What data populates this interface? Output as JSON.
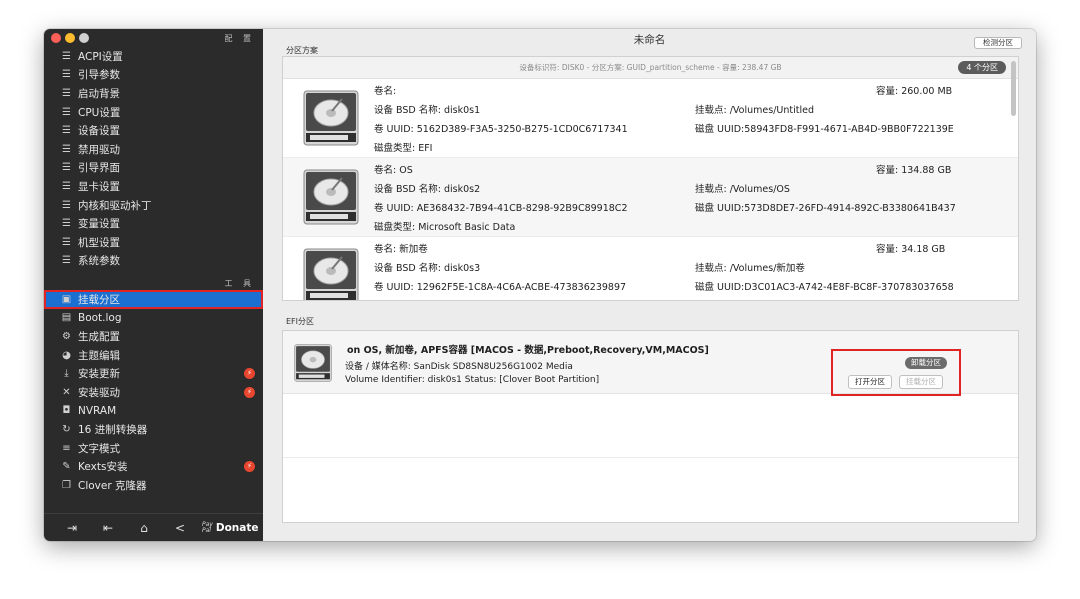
{
  "window": {
    "title": "未命名",
    "detect_button": "检测分区"
  },
  "sidebar": {
    "section_config": "配 置",
    "section_tools": "工 具",
    "config_items": [
      {
        "label": "ACPI设置",
        "icon": "list-icon"
      },
      {
        "label": "引导参数",
        "icon": "list-icon"
      },
      {
        "label": "启动背景",
        "icon": "list-icon"
      },
      {
        "label": "CPU设置",
        "icon": "list-icon"
      },
      {
        "label": "设备设置",
        "icon": "list-icon"
      },
      {
        "label": "禁用驱动",
        "icon": "list-icon"
      },
      {
        "label": "引导界面",
        "icon": "list-icon"
      },
      {
        "label": "显卡设置",
        "icon": "list-icon"
      },
      {
        "label": "内核和驱动补丁",
        "icon": "list-icon"
      },
      {
        "label": "变量设置",
        "icon": "list-icon"
      },
      {
        "label": "机型设置",
        "icon": "list-icon"
      },
      {
        "label": "系统参数",
        "icon": "list-icon"
      }
    ],
    "tool_items": [
      {
        "label": "挂载分区",
        "icon": "disk-icon"
      },
      {
        "label": "Boot.log",
        "icon": "log-icon"
      },
      {
        "label": "生成配置",
        "icon": "gears-icon"
      },
      {
        "label": "主题编辑",
        "icon": "palette-icon"
      },
      {
        "label": "安装更新",
        "icon": "download-icon"
      },
      {
        "label": "安装驱动",
        "icon": "tools-icon"
      },
      {
        "label": "NVRAM",
        "icon": "chip-icon"
      },
      {
        "label": "16 进制转换器",
        "icon": "refresh-icon"
      },
      {
        "label": "文字模式",
        "icon": "text-icon"
      },
      {
        "label": "Kexts安装",
        "icon": "brush-icon"
      },
      {
        "label": "Clover 克隆器",
        "icon": "clone-icon"
      }
    ],
    "donate": {
      "paypal_top": "Pay",
      "paypal_bottom": "Pal",
      "label": "Donate"
    }
  },
  "partitions": {
    "section_label": "分区方案",
    "header": "设备标识符: DISK0 - 分区方案: GUID_partition_scheme - 容量: 238.47 GB",
    "count_badge": "4 个分区",
    "rows": [
      {
        "name": "卷名:",
        "capacity": "容量:  260.00 MB",
        "bsd": "设备 BSD 名称: disk0s1",
        "mount": "挂载点: /Volumes/Untitled",
        "uuid": "卷 UUID: 5162D389-F3A5-3250-B275-1CD0C6717341",
        "disk_uuid": "磁盘 UUID:58943FD8-F991-4671-AB4D-9BB0F722139E",
        "type": "磁盘类型: EFI"
      },
      {
        "name": "卷名: OS",
        "capacity": "容量:  134.88 GB",
        "bsd": "设备 BSD 名称: disk0s2",
        "mount": "挂载点: /Volumes/OS",
        "uuid": "卷 UUID: AE368432-7B94-41CB-8298-92B9C89918C2",
        "disk_uuid": "磁盘 UUID:573D8DE7-26FD-4914-892C-B3380641B437",
        "type": "磁盘类型: Microsoft Basic Data"
      },
      {
        "name": "卷名: 新加卷",
        "capacity": "容量:  34.18 GB",
        "bsd": "设备 BSD 名称: disk0s3",
        "mount": "挂载点: /Volumes/新加卷",
        "uuid": "卷 UUID: 12962F5E-1C8A-4C6A-ACBE-473836239897",
        "disk_uuid": "磁盘 UUID:D3C01AC3-A742-4E8F-BC8F-370783037658",
        "type": ""
      }
    ]
  },
  "efi": {
    "section_label": "EFI分区",
    "title": "on OS, 新加卷, APFS容器 [MACOS - 数据,Preboot,Recovery,VM,MACOS]",
    "media": "设备 / 媒体名称: SanDisk SD8SN8U256G1002 Media",
    "volume": "Volume Identifier: disk0s1 Status: [Clover Boot Partition]",
    "unmount_button": "卸载分区",
    "open_button": "打开分区",
    "mount_button": "挂载分区"
  },
  "colors": {
    "sidebar_bg": "#2b2b2b",
    "selected": "#1a6fd1",
    "highlight": "#e02424",
    "badge": "#e8462f"
  }
}
